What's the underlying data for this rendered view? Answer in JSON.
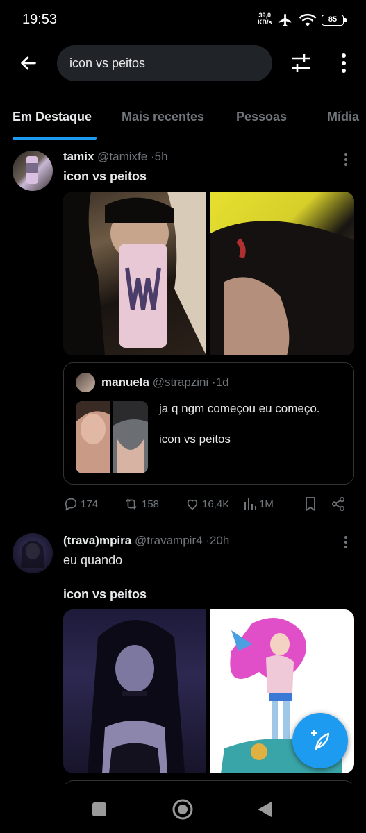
{
  "status_bar": {
    "time": "19:53",
    "net_speed_value": "39,0",
    "net_speed_unit": "KB/s",
    "battery": "85"
  },
  "header": {
    "search_value": "icon vs peitos"
  },
  "tabs": [
    {
      "label": "Em Destaque",
      "active": true
    },
    {
      "label": "Mais recentes",
      "active": false
    },
    {
      "label": "Pessoas",
      "active": false
    },
    {
      "label": "Mídia",
      "active": false
    }
  ],
  "posts": [
    {
      "name": "tamix",
      "handle": "@tamixfe",
      "time": "5h",
      "text": "icon vs peitos",
      "quote": {
        "name": "manuela",
        "handle": "@strapzini",
        "time": "1d",
        "text_line1": "ja q ngm começou eu começo.",
        "text_line2": "icon vs peitos"
      },
      "actions": {
        "replies": "174",
        "reposts": "158",
        "likes": "16,4K",
        "views": "1M"
      }
    },
    {
      "name": "(trava)mpira",
      "handle": "@travampir4",
      "time": "20h",
      "text_line1": "eu quando",
      "text_line2": "icon vs peitos"
    }
  ],
  "colors": {
    "accent": "#1d9bf0",
    "background": "#000000",
    "muted_text": "#71767b"
  }
}
